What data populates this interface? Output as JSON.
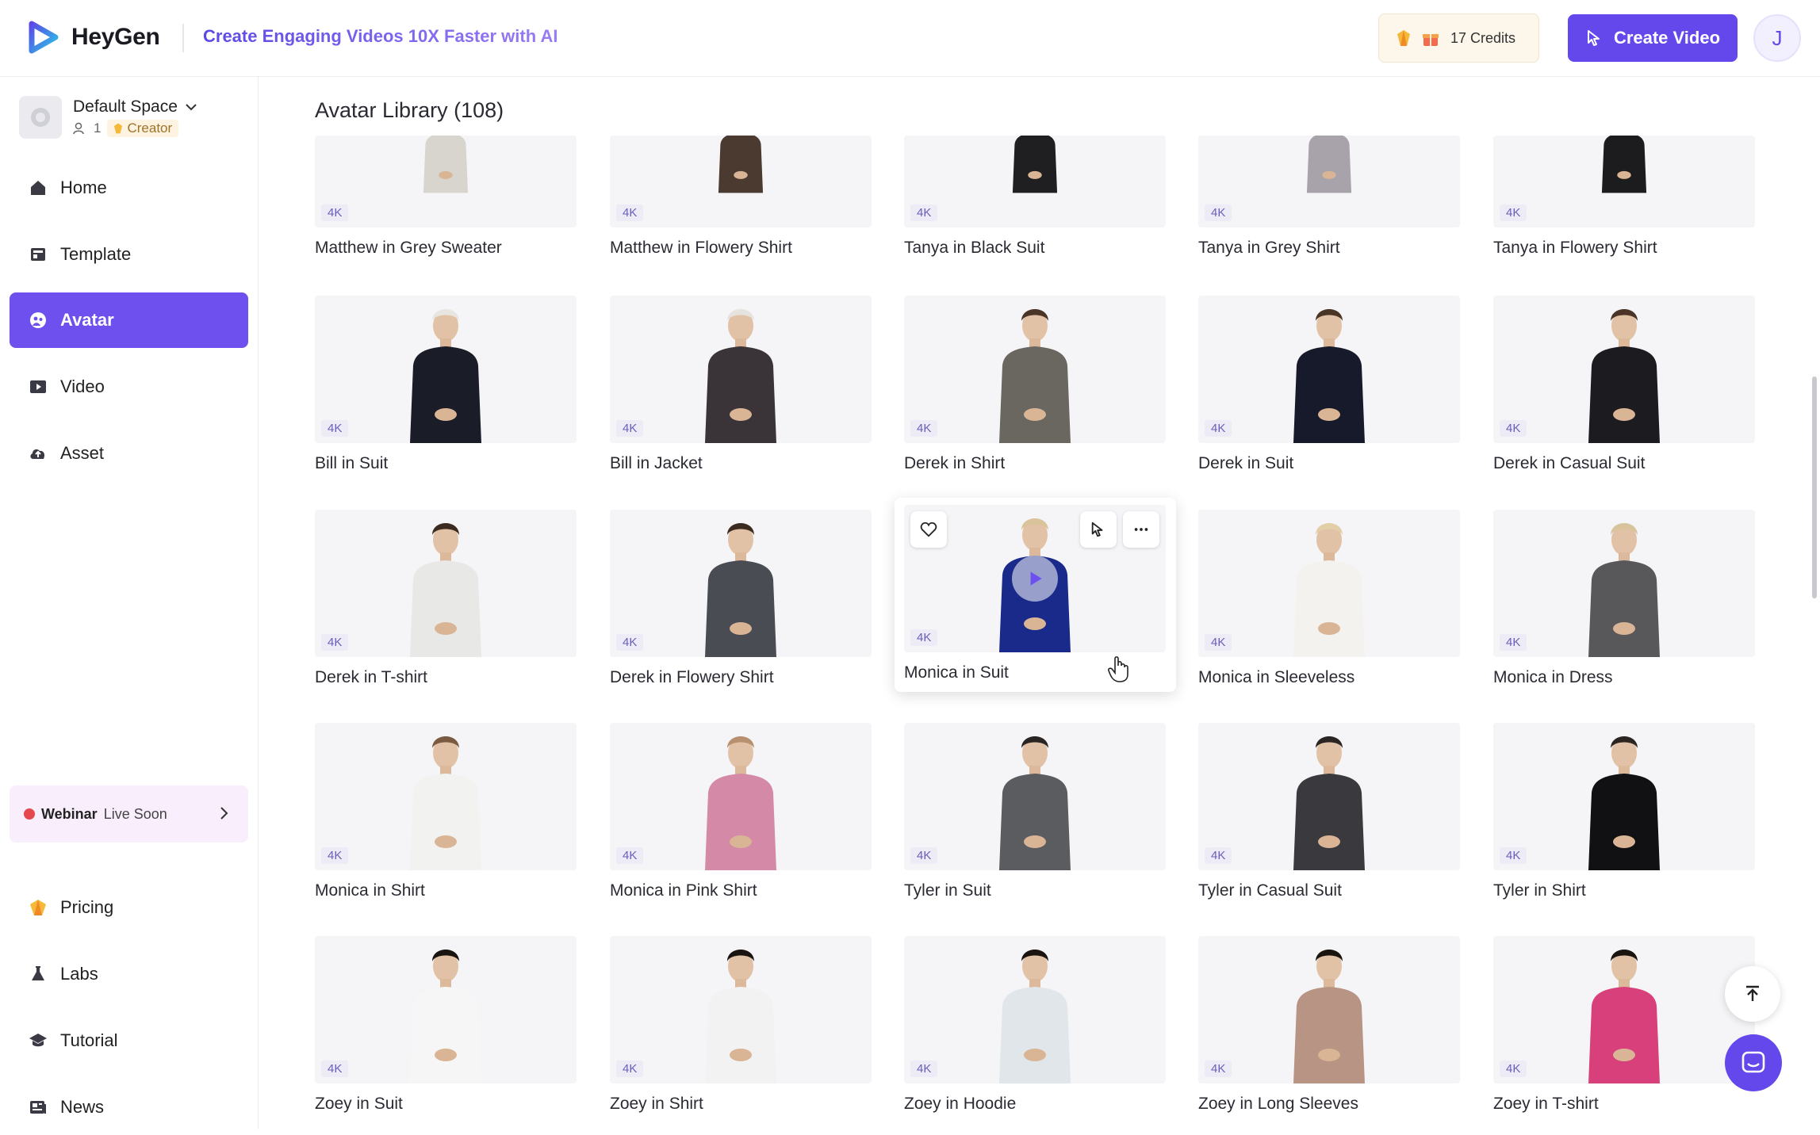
{
  "app": {
    "name": "HeyGen",
    "tagline": "Create Engaging Videos 10X Faster with AI",
    "credits": "17 Credits",
    "create_video": "Create Video",
    "user_initial": "J"
  },
  "space": {
    "name": "Default Space",
    "members": "1",
    "plan": "Creator"
  },
  "nav": [
    {
      "label": "Home",
      "icon": "home-icon"
    },
    {
      "label": "Template",
      "icon": "template-icon"
    },
    {
      "label": "Avatar",
      "icon": "avatar-icon",
      "active": true
    },
    {
      "label": "Video",
      "icon": "video-icon"
    },
    {
      "label": "Asset",
      "icon": "asset-icon"
    }
  ],
  "webinar": {
    "bold": "Webinar",
    "text": "Live Soon"
  },
  "nav_bottom": [
    {
      "label": "Pricing",
      "icon": "pricing-icon"
    },
    {
      "label": "Labs",
      "icon": "labs-icon"
    },
    {
      "label": "Tutorial",
      "icon": "tutorial-icon"
    },
    {
      "label": "News",
      "icon": "news-icon"
    }
  ],
  "library": {
    "title": "Avatar Library (108)",
    "badge": "4K",
    "rows": [
      [
        "Matthew in Grey Sweater",
        "Matthew in Flowery Shirt",
        "Tanya in Black Suit",
        "Tanya in Grey Shirt",
        "Tanya in Flowery Shirt"
      ],
      [
        "Bill in Suit",
        "Bill in Jacket",
        "Derek in Shirt",
        "Derek in Suit",
        "Derek in Casual Suit"
      ],
      [
        "Derek in T-shirt",
        "Derek in Flowery Shirt",
        "Monica in Suit",
        "Monica in Sleeveless",
        "Monica in Dress"
      ],
      [
        "Monica in Shirt",
        "Monica in Pink Shirt",
        "Tyler in Suit",
        "Tyler in Casual Suit",
        "Tyler in Shirt"
      ],
      [
        "Zoey in Suit",
        "Zoey in Shirt",
        "Zoey in Hoodie",
        "Zoey in Long Sleeves",
        "Zoey in T-shirt"
      ]
    ],
    "colors": [
      [
        [
          "#d8d5cf",
          "#5a4636"
        ],
        [
          "#4a3a30",
          "#6b5240"
        ],
        [
          "#1f1f22",
          "#3a2c22"
        ],
        [
          "#a8a3aa",
          "#8a6c58"
        ],
        [
          "#1c1c1e",
          "#6b4a30"
        ]
      ],
      [
        [
          "#1a1c28",
          "#e9e6e2"
        ],
        [
          "#3a3438",
          "#e6e2de"
        ],
        [
          "#6a6660",
          "#4a3426"
        ],
        [
          "#171a2a",
          "#4a3426"
        ],
        [
          "#1c1c20",
          "#4a3426"
        ]
      ],
      [
        [
          "#e8e8e6",
          "#3a2a20"
        ],
        [
          "#4a4c54",
          "#3a2a20"
        ],
        [
          "#1a2a8a",
          "#d9c39a"
        ],
        [
          "#f4f2ee",
          "#e2cfa8"
        ],
        [
          "#58585a",
          "#d8c49c"
        ]
      ],
      [
        [
          "#f2f2f0",
          "#7a5a40"
        ],
        [
          "#d48aa6",
          "#b89070"
        ],
        [
          "#5a5c60",
          "#2a2422"
        ],
        [
          "#3a3a3e",
          "#2a2422"
        ],
        [
          "#111113",
          "#2a2422"
        ]
      ],
      [
        [
          "#f6f6f6",
          "#1a1410"
        ],
        [
          "#f2f2f2",
          "#1a1410"
        ],
        [
          "#e0e6ea",
          "#1a1410"
        ],
        [
          "#b89484",
          "#1a1410"
        ],
        [
          "#d8407c",
          "#1a1410"
        ]
      ]
    ]
  }
}
